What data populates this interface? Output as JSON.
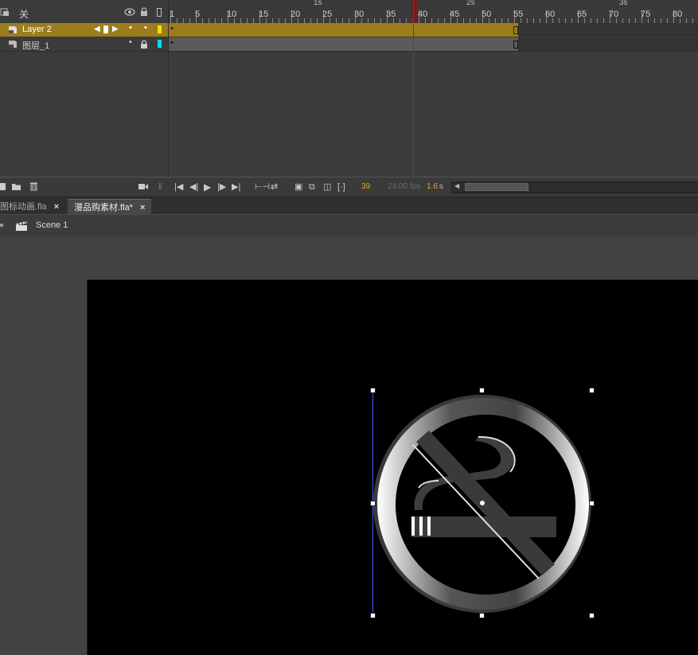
{
  "timeline": {
    "header_label": "关",
    "ruler_numbers": [
      "1",
      "5",
      "10",
      "15",
      "20",
      "25",
      "30",
      "35",
      "40",
      "45",
      "50",
      "55",
      "60",
      "65",
      "70",
      "75",
      "80"
    ],
    "seconds": [
      "1s",
      "2s",
      "3s"
    ],
    "layers": [
      {
        "name": "Layer 2",
        "color": "#ffde00",
        "selected": true
      },
      {
        "name": "图层_1",
        "color": "#00e0ff",
        "selected": false
      }
    ],
    "current_frame": "39",
    "fps": "24.00 fps",
    "elapsed": "1.6",
    "elapsed_unit": "s",
    "playhead_frame": 39
  },
  "doc_tabs": [
    {
      "label": "图标动画.fla",
      "close": "×",
      "active": false
    },
    {
      "label": "漫品购素材.fla*",
      "close": "×",
      "active": true
    }
  ],
  "edit_bar": {
    "scene_label": "Scene 1"
  },
  "icons": {
    "eye": "eye-icon",
    "lock": "lock-icon",
    "outline": "outline-icon",
    "new_layer": "new-layer-icon",
    "new_folder": "new-folder-icon",
    "delete": "trash-icon",
    "scene": "clapperboard-icon"
  },
  "colors": {
    "selected_layer_bg": "#9c7c1c",
    "playhead": "#b31d1d",
    "accent_number": "#e6a817",
    "stage_bg": "#000000"
  }
}
